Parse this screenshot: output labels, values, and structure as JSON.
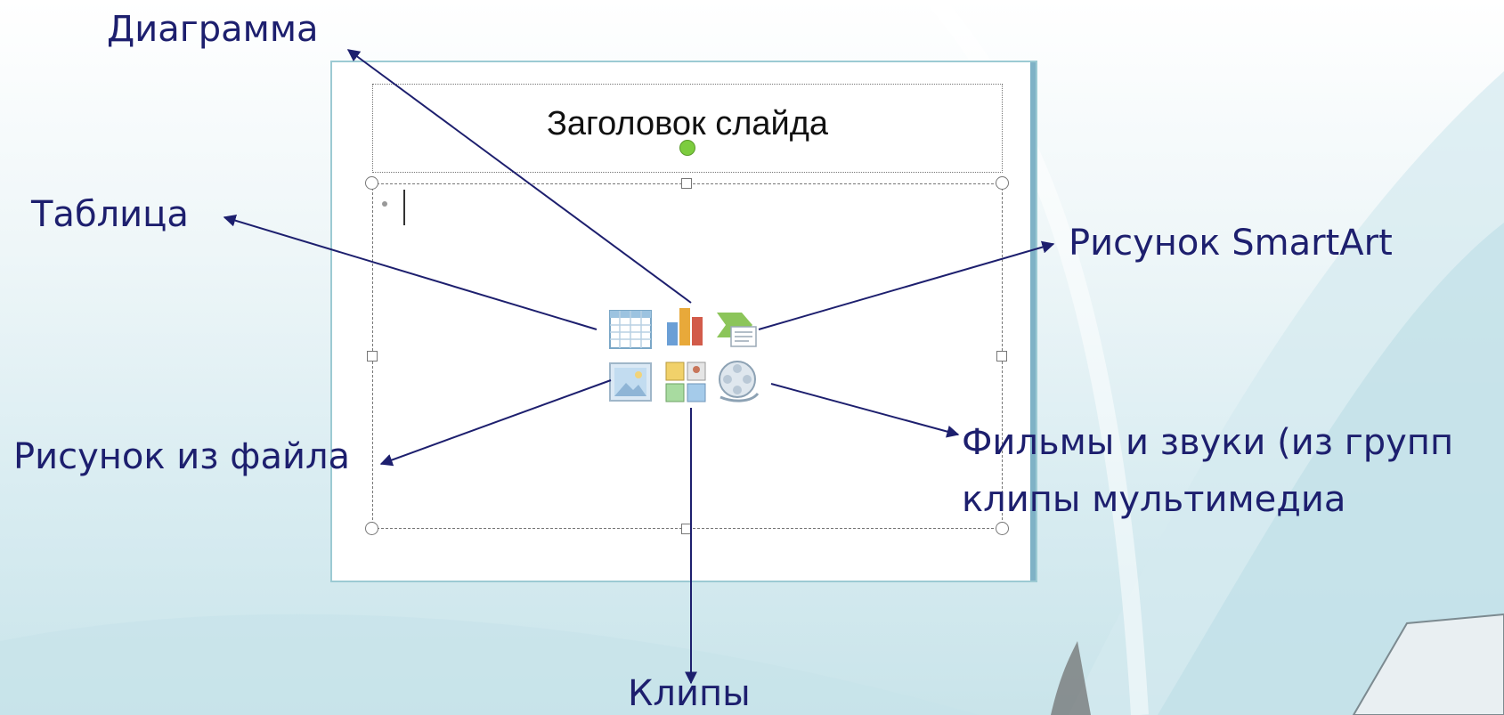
{
  "slide": {
    "title_placeholder": "Заголовок слайда"
  },
  "labels": {
    "chart": "Диаграмма",
    "table": "Таблица",
    "smartart": "Рисунок SmartArt",
    "picture_from_file": "Рисунок из файла",
    "media_line1": "Фильмы и звуки (из групп",
    "media_line2": "клипы мультимедиа",
    "clips": "Клипы"
  },
  "icons": [
    "table-icon",
    "chart-icon",
    "smartart-icon",
    "picture-icon",
    "clipart-icon",
    "media-clip-icon"
  ],
  "colors": {
    "label_text": "#1d1f6e",
    "slide_border": "#9ccad3",
    "rotate_handle": "#7ccc3e"
  }
}
